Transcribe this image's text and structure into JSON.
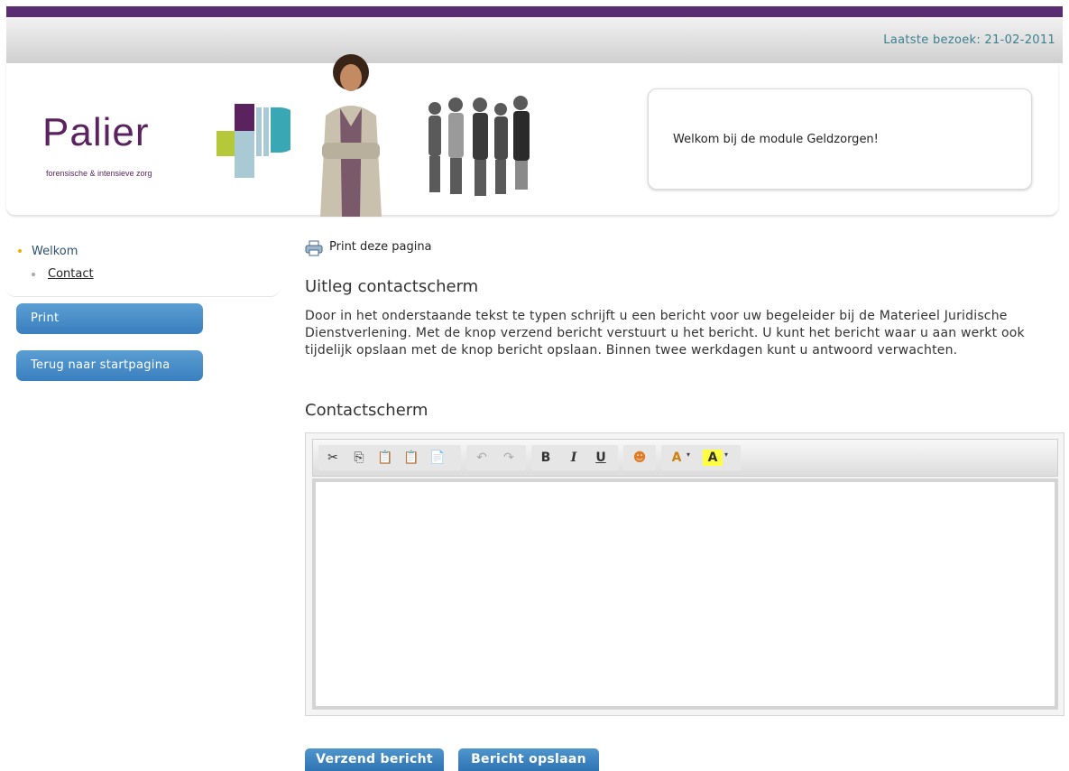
{
  "header": {
    "last_visit": "Laatste bezoek: 21-02-2011",
    "logo_word": "Palier",
    "logo_sub": "forensische & intensieve zorg",
    "welcome": "Welkom bij de module Geldzorgen!"
  },
  "nav": {
    "items": [
      {
        "label": "Welkom"
      },
      {
        "label": "Contact"
      }
    ],
    "buttons": [
      {
        "label": "Print"
      },
      {
        "label": "Terug naar startpagina"
      }
    ]
  },
  "main": {
    "print_link": "Print deze pagina",
    "heading1": "Uitleg contactscherm",
    "intro": "Door in het onderstaande tekst te typen schrijft u een bericht voor uw begeleider bij de Materieel Juridische Dienstverlening.  Met de knop verzend bericht verstuurt u het bericht. U kunt het bericht waar u aan werkt ook tijdelijk opslaan met de knop bericht opslaan. Binnen twee werkdagen kunt u antwoord verwachten.",
    "heading2": "Contactscherm",
    "toolbar": {
      "bold": "B",
      "italic": "I",
      "underline": "U",
      "font_color": "A",
      "highlight": "A"
    },
    "send_button": "Verzend bericht",
    "save_button": "Bericht opslaan"
  },
  "colors": {
    "brand_purple": "#5a2d73",
    "button_blue": "#3a7fbf",
    "visit_text": "#3d7f8f"
  }
}
